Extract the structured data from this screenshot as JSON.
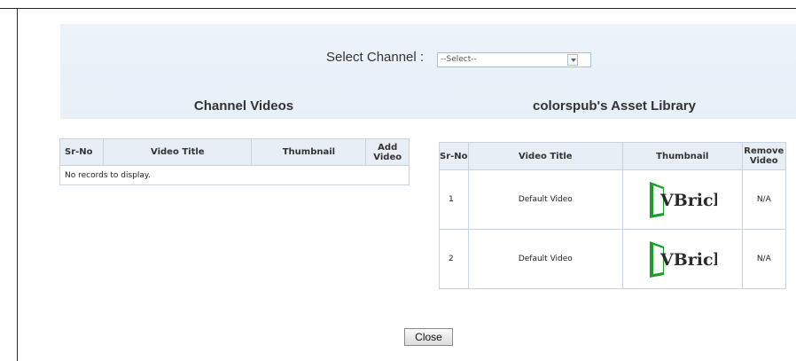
{
  "select": {
    "label": "Select Channel :",
    "value": "--Select--"
  },
  "channel_videos": {
    "title": "Channel Videos",
    "columns": [
      "Sr-No",
      "Video Title",
      "Thumbnail",
      "Add Video"
    ],
    "empty_message": "No records to display."
  },
  "asset_library": {
    "title": "colorspub's Asset Library",
    "columns": [
      "Sr-No",
      "Video Title",
      "Thumbnail",
      "Remove Video"
    ],
    "rows": [
      {
        "sr": "1",
        "title": "Default Video",
        "thumb_logo": "VBrick",
        "remove": "N/A"
      },
      {
        "sr": "2",
        "title": "Default Video",
        "thumb_logo": "VBrick",
        "remove": "N/A"
      }
    ]
  },
  "close_label": "Close",
  "colors": {
    "header_band": "#e7eff8",
    "grid_header": "#e8eef6",
    "vbrick_green": "#1e9c2c"
  }
}
